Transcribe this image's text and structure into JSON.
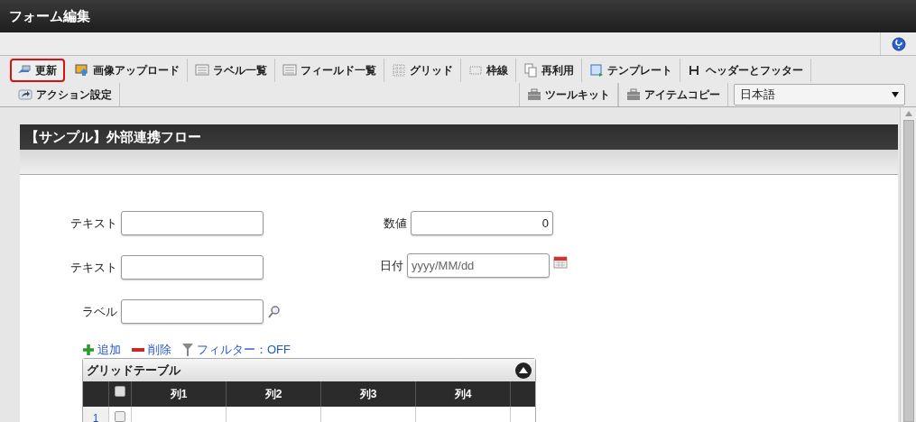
{
  "window": {
    "title": "フォーム編集"
  },
  "toolbar": {
    "row_1": [
      {
        "label": "更新",
        "kind": "update",
        "selected": true
      },
      {
        "label": "画像アップロード",
        "kind": "image",
        "selected": false
      },
      {
        "label": "ラベル一覧",
        "kind": "list",
        "selected": false
      },
      {
        "label": "フィールド一覧",
        "kind": "list",
        "selected": false
      },
      {
        "label": "グリッド",
        "kind": "grid",
        "selected": false
      },
      {
        "label": "枠線",
        "kind": "border",
        "selected": false
      },
      {
        "label": "再利用",
        "kind": "copy",
        "selected": false
      },
      {
        "label": "テンプレート",
        "kind": "template",
        "selected": false
      },
      {
        "label": "ヘッダーとフッター",
        "kind": "header",
        "selected": false
      }
    ],
    "row_2_left": [
      {
        "label": "アクション設定",
        "kind": "share",
        "selected": false
      }
    ],
    "row_2_right": [
      {
        "label": "ツールキット",
        "kind": "toolbox",
        "selected": false
      },
      {
        "label": "アイテムコピー",
        "kind": "toolbox",
        "selected": false
      }
    ],
    "language": "日本語"
  },
  "form": {
    "title": "【サンプル】外部連携フロー",
    "fields_left": [
      {
        "kind": "text",
        "label": "テキスト"
      },
      {
        "kind": "text",
        "label": "テキスト"
      },
      {
        "kind": "lookup",
        "label": "ラベル"
      }
    ],
    "fields_right": [
      {
        "kind": "number",
        "label": "数値",
        "value": "0"
      },
      {
        "kind": "date",
        "label": "日付",
        "placeholder": "yyyy/MM/dd"
      }
    ],
    "actions": [
      {
        "kind": "add",
        "label": "追加"
      },
      {
        "kind": "delete",
        "label": "削除"
      },
      {
        "kind": "filter",
        "label": "フィルター：OFF"
      }
    ],
    "grid": {
      "title": "グリッドテーブル",
      "all_checked": false,
      "columns": [
        "列1",
        "列2",
        "列3",
        "列4"
      ],
      "rows": [
        {
          "number": "1",
          "checked": false
        }
      ]
    }
  }
}
